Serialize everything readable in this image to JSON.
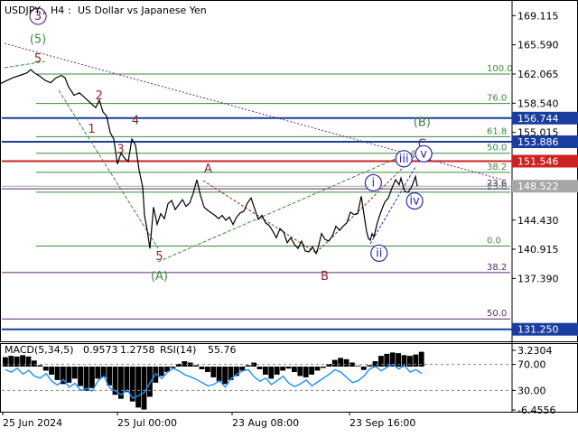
{
  "header": {
    "symbol": "USDJPY",
    "timeframe": "H4",
    "description": "US Dollar vs Japanese Yen"
  },
  "colors": {
    "price_line": "#000000",
    "wave_red": "#8b2a2a",
    "wave_green": "#3c8a3c",
    "wave_purple": "#6a2a8a",
    "wave_blue": "#2a2aa8",
    "fib_green": "#3c8a3c",
    "fib_purple": "#5a2a6a",
    "level_blue": "#1a3ea0",
    "level_red": "#cc2222",
    "level_gray": "#a6a6a6",
    "macd_hist": "#000000",
    "rsi_line": "#1e90ff",
    "bottom_label": "#1a3ea0"
  },
  "chart_data": [
    {
      "type": "line",
      "title": "USDJPY, H4: US Dollar vs Japanese Yen",
      "y_axis_ticks": [
        "169.115",
        "165.590",
        "162.065",
        "158.540",
        "155.015",
        "151.546",
        "148.522",
        "144.430",
        "140.915",
        "137.390",
        "131.250"
      ],
      "ylim": [
        129.8,
        171.0
      ],
      "x_axis_ticks": [
        "25 Jun 2024",
        "25 Jul 00:00",
        "23 Aug 08:00",
        "23 Sep 16:00"
      ],
      "series": [
        {
          "x_index": [
            0,
            6,
            14,
            22,
            30,
            34,
            38,
            44,
            50,
            56,
            62,
            68,
            72,
            76,
            82,
            88,
            94,
            100,
            106,
            110,
            114,
            118,
            122,
            126,
            130,
            134,
            138,
            142,
            146,
            150,
            154,
            158,
            160,
            163,
            166,
            170,
            174,
            178,
            182,
            186,
            190,
            194,
            198,
            202,
            206,
            210,
            214,
            218,
            222,
            226,
            230,
            234,
            238,
            242,
            246,
            250,
            254,
            258,
            262,
            266,
            270,
            274,
            278,
            282,
            286,
            290,
            294,
            298,
            302,
            306,
            310,
            314,
            318,
            322,
            326,
            330,
            334,
            338,
            342,
            346,
            350,
            352,
            356,
            360,
            364,
            368,
            372,
            376,
            380,
            384,
            388,
            392,
            396,
            400,
            404,
            406,
            408,
            410,
            412,
            414,
            418,
            422,
            426,
            430,
            434,
            438,
            442,
            444,
            448,
            452,
            456,
            460,
            462
          ],
          "values": [
            160.9,
            161.2,
            161.6,
            161.9,
            162.2,
            162.6,
            162.2,
            161.8,
            161.3,
            161.0,
            161.6,
            161.9,
            161.6,
            160.5,
            159.5,
            159.8,
            159.2,
            158.6,
            158.0,
            158.9,
            157.5,
            157.0,
            155.0,
            154.2,
            151.2,
            152.5,
            151.9,
            151.5,
            154.2,
            153.5,
            150.5,
            148.4,
            145.0,
            143.2,
            141.0,
            146.0,
            143.9,
            145.2,
            144.6,
            146.4,
            146.8,
            145.7,
            146.3,
            146.9,
            146.1,
            146.5,
            147.7,
            149.3,
            147.4,
            146.0,
            145.6,
            145.3,
            145.0,
            144.6,
            145.0,
            144.4,
            144.8,
            143.9,
            144.8,
            145.3,
            145.5,
            146.5,
            147.1,
            145.8,
            144.5,
            145.0,
            144.1,
            143.8,
            143.1,
            142.3,
            143.4,
            143.0,
            141.7,
            142.3,
            141.5,
            141.0,
            141.9,
            140.7,
            140.6,
            141.2,
            140.4,
            141.0,
            142.8,
            142.1,
            141.9,
            142.5,
            143.7,
            143.2,
            143.7,
            144.1,
            145.4,
            145.1,
            145.2,
            147.3,
            144.4,
            143.0,
            142.2,
            142.0,
            142.8,
            142.4,
            144.2,
            145.5,
            146.6,
            147.1,
            148.3,
            149.3,
            148.7,
            149.5,
            147.9,
            147.8,
            148.5,
            149.7,
            148.5
          ]
        }
      ],
      "horizontal_levels": [
        {
          "label": "100.0",
          "value": 162.065,
          "style": "fib_green"
        },
        {
          "label": "76.0",
          "value": 158.5,
          "style": "fib_green"
        },
        {
          "label": "61.8",
          "value": 154.5,
          "style": "fib_green"
        },
        {
          "label": "50.0",
          "value": 152.5,
          "style": "fib_green"
        },
        {
          "label": "38.2",
          "value": 150.2,
          "style": "fib_green"
        },
        {
          "label": "23.6",
          "value": 147.8,
          "style": "fib_green"
        },
        {
          "label": "0.0",
          "value": 141.3,
          "style": "fib_green"
        },
        {
          "label": "23.6",
          "value": 148.2,
          "style": "fib_purple"
        },
        {
          "label": "38.2",
          "value": 138.1,
          "style": "fib_purple"
        },
        {
          "label": "50.0",
          "value": 132.5,
          "style": "fib_purple"
        },
        {
          "label": "156.744",
          "value": 156.744,
          "style": "level_blue"
        },
        {
          "label": "153.886",
          "value": 153.886,
          "style": "level_blue"
        },
        {
          "label": "151.546",
          "value": 151.546,
          "style": "level_red"
        },
        {
          "label": "148.522",
          "value": 148.522,
          "style": "level_gray"
        },
        {
          "label": "131.250",
          "value": 131.25,
          "style": "level_blue"
        }
      ],
      "wave_labels": [
        {
          "text": "3",
          "style": "wave_purple_circle",
          "x_index": 46,
          "y": 168.6
        },
        {
          "text": "(5)",
          "style": "wave_green",
          "x_index": 46,
          "y": 165.8
        },
        {
          "text": "5",
          "style": "wave_red",
          "x_index": 46,
          "y": 163.5
        },
        {
          "text": "2",
          "style": "wave_red",
          "x_index": 120,
          "y": 159.0
        },
        {
          "text": "1",
          "style": "wave_red",
          "x_index": 111,
          "y": 155.0
        },
        {
          "text": "4",
          "style": "wave_red",
          "x_index": 164,
          "y": 156.0
        },
        {
          "text": "3",
          "style": "wave_red",
          "x_index": 146,
          "y": 152.5
        },
        {
          "text": "A",
          "style": "wave_red",
          "x_index": 252,
          "y": 150.2
        },
        {
          "text": "5",
          "style": "wave_red",
          "x_index": 193,
          "y": 139.6
        },
        {
          "text": "(A)",
          "style": "wave_green",
          "x_index": 193,
          "y": 137.2
        },
        {
          "text": "B",
          "style": "wave_red",
          "x_index": 393,
          "y": 137.2
        },
        {
          "text": "(B)",
          "style": "wave_green",
          "x_index": 511,
          "y": 155.8
        },
        {
          "text": "C",
          "style": "wave_red",
          "x_index": 511,
          "y": 153.2
        },
        {
          "text": "i",
          "style": "wave_blue_circle",
          "x_index": 452,
          "y": 148.5
        },
        {
          "text": "ii",
          "style": "wave_blue_circle",
          "x_index": 459,
          "y": 140.0
        },
        {
          "text": "iii",
          "style": "wave_blue_circle",
          "x_index": 489,
          "y": 151.4
        },
        {
          "text": "iv",
          "style": "wave_blue_circle",
          "x_index": 502,
          "y": 146.3
        },
        {
          "text": "v",
          "style": "wave_blue_circle",
          "x_index": 513,
          "y": 152.0
        }
      ]
    },
    {
      "type": "bar",
      "title": "MACD(5,34,5) 0.9573 1.2758 RSI(14) 55.76",
      "indicator_name": "MACD(5,34,5)",
      "macd_value": "0.9573",
      "signal_value": "1.2758",
      "rsi_name": "RSI(14)",
      "rsi_value": "55.76",
      "y_axis_ticks": [
        "3.2304",
        "70.00",
        "30.00",
        "-6.4556"
      ],
      "ylim": [
        -6.4556,
        3.2304
      ],
      "rsi_levels": [
        70,
        30
      ],
      "histogram": [
        1.4,
        1.6,
        1.5,
        1.7,
        1.5,
        0.9,
        0.2,
        -0.6,
        -1.2,
        -2.0,
        -2.6,
        -2.4,
        -1.8,
        -2.9,
        -3.6,
        -3.2,
        -1.8,
        -1.6,
        -2.8,
        -4.2,
        -4.8,
        -3.8,
        -5.2,
        -6.1,
        -6.4,
        -4.5,
        -2.4,
        -1.4,
        -0.8,
        -0.2,
        0.4,
        0.8,
        0.6,
        0.2,
        -0.4,
        -0.8,
        -1.6,
        -2.2,
        -2.6,
        -2.0,
        -1.4,
        -0.6,
        0.2,
        0.6,
        -0.4,
        -1.2,
        -1.8,
        -1.2,
        -0.6,
        -0.3,
        -0.8,
        -1.4,
        -1.6,
        -1.2,
        -0.6,
        -0.2,
        0.4,
        1.0,
        1.3,
        1.1,
        0.6,
        0.1,
        -0.5,
        0.2,
        0.8,
        1.6,
        1.9,
        2.1,
        2.0,
        1.7,
        1.6,
        1.8,
        2.2
      ],
      "rsi": [
        62,
        58,
        64,
        55,
        61,
        52,
        49,
        56,
        44,
        38,
        47,
        35,
        41,
        30,
        33,
        29,
        45,
        52,
        34,
        29,
        23,
        31,
        18,
        22,
        27,
        42,
        56,
        48,
        58,
        64,
        60,
        54,
        51,
        47,
        42,
        37,
        39,
        45,
        35,
        48,
        55,
        60,
        62,
        51,
        44,
        49,
        39,
        45,
        52,
        41,
        36,
        40,
        46,
        37,
        43,
        49,
        55,
        62,
        58,
        50,
        42,
        45,
        52,
        63,
        67,
        60,
        66,
        70,
        63,
        68,
        58,
        62,
        56
      ]
    }
  ]
}
